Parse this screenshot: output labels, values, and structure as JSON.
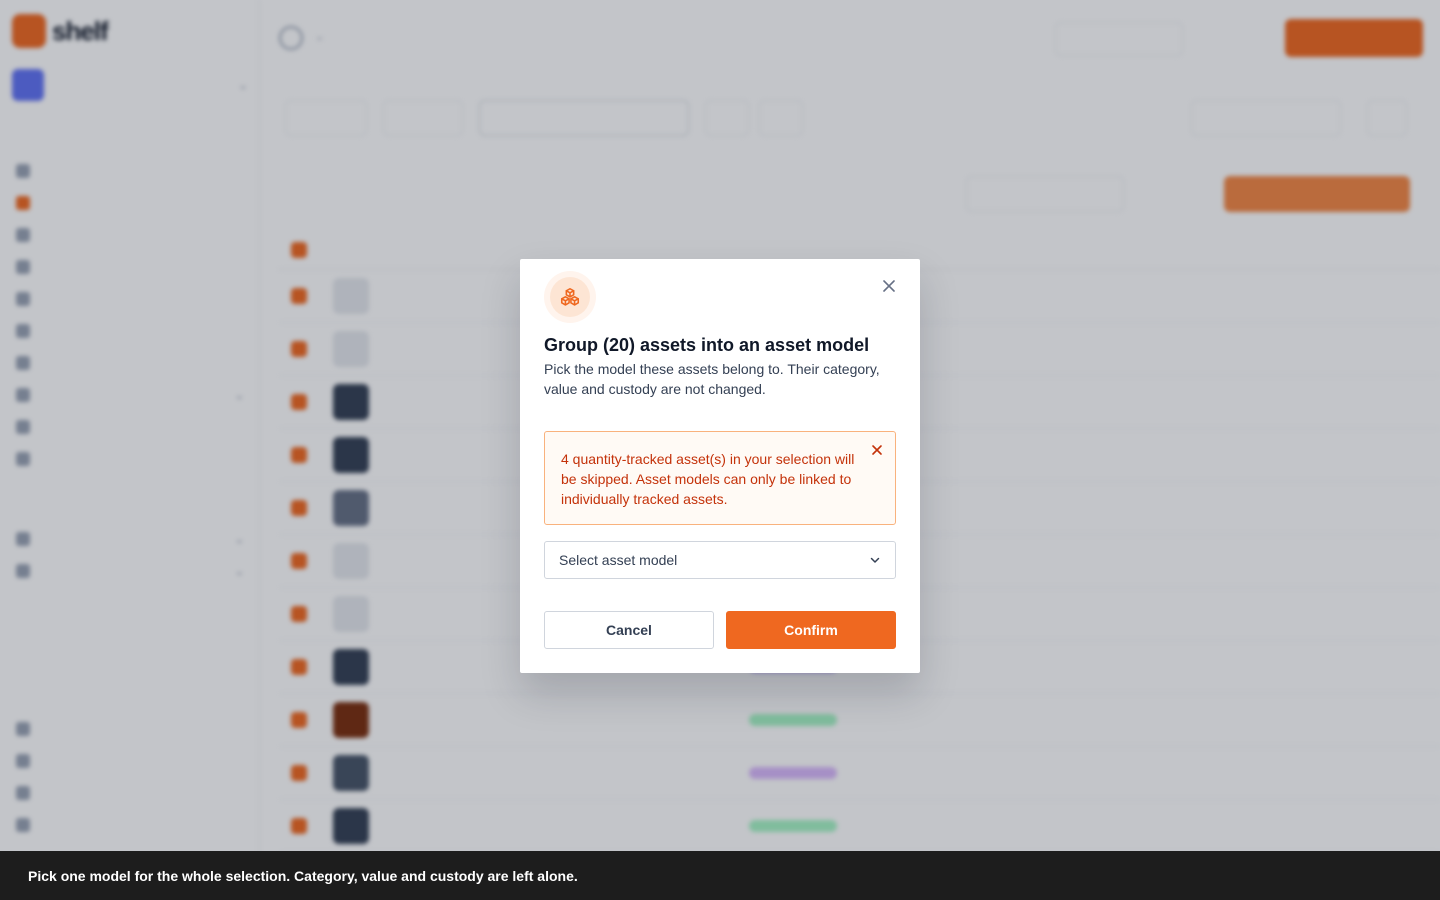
{
  "modal": {
    "title": "Group (20) assets into an asset model",
    "description": "Pick the model these assets belong to. Their category, value and custody are not changed.",
    "icon": "asset-model-icon",
    "close_icon": "close-icon",
    "warning": {
      "text": "4 quantity-tracked asset(s) in your selection will be skipped. Asset models can only be linked to individually tracked assets.",
      "close_icon": "close-icon"
    },
    "select": {
      "placeholder": "Select asset model",
      "icon": "chevron-down-icon"
    },
    "cancel_label": "Cancel",
    "confirm_label": "Confirm"
  },
  "caption": {
    "text": "Pick one model for the whole selection. Category, value and custody are left alone."
  },
  "colors": {
    "accent": "#ef6820",
    "warning_border": "#f9b27d",
    "warning_bg": "#fffaf5",
    "warning_text": "#c4320a",
    "caption_bg": "#1d1d1d"
  }
}
